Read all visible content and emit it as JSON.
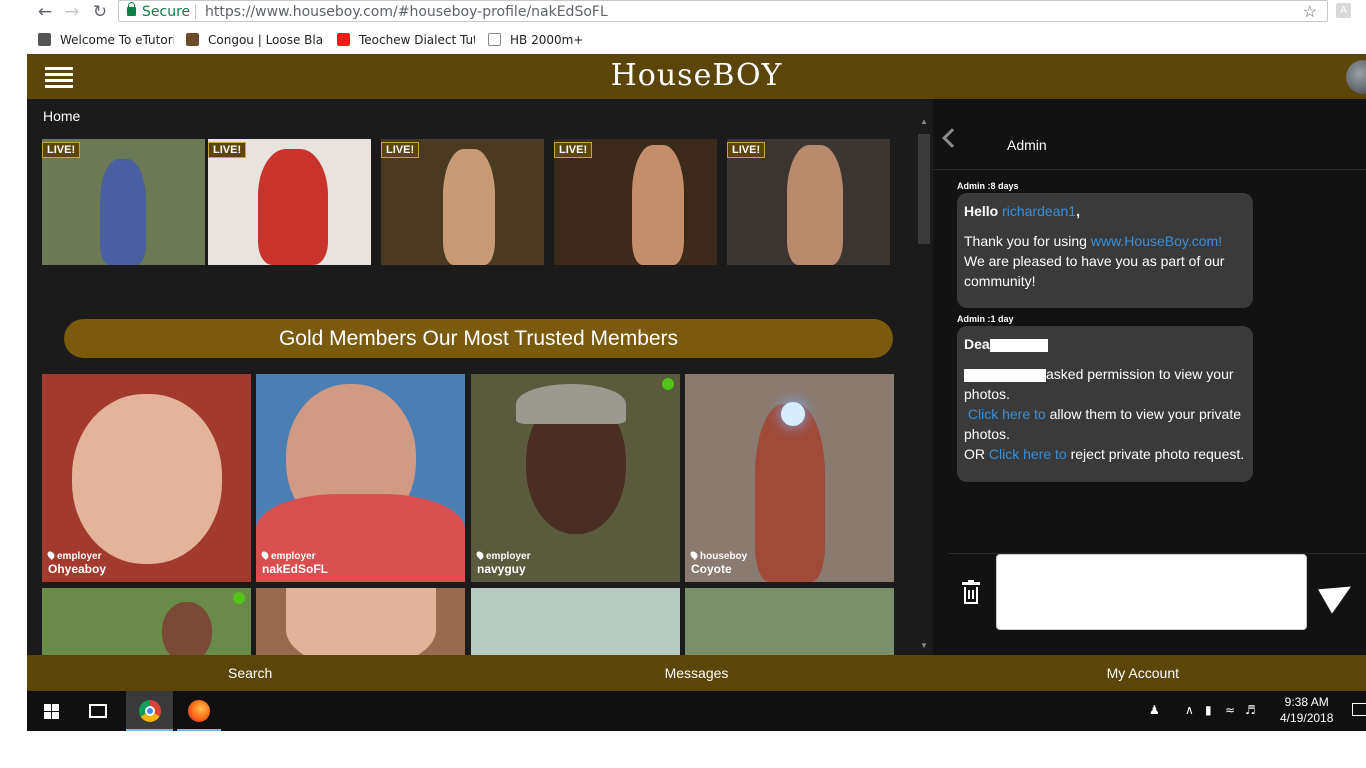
{
  "browser": {
    "back_icon": "back-arrow-icon",
    "forward_icon": "forward-arrow-icon",
    "reload_icon": "reload-icon",
    "secure_label": "Secure",
    "url": "https://www.houseboy.com/#houseboy-profile/nakEdSoFL",
    "extension_label": "A",
    "bookmarks": [
      {
        "label": "Welcome To eTutorin",
        "color": "#555555"
      },
      {
        "label": "Congou | Loose Black",
        "color": "#6b4b2a"
      },
      {
        "label": "Teochew Dialect Tuto",
        "color": "#e62117"
      },
      {
        "label": "HB 2000m+",
        "color": "#ffffff"
      }
    ]
  },
  "app": {
    "brand": "HouseBOY",
    "breadcrumb": "Home",
    "accent": "#5c4509",
    "live_badge": "LIVE!",
    "live_streams": [
      {
        "badge": "LIVE!",
        "bg": "#6b7a55"
      },
      {
        "badge": "LIVE!",
        "bg": "#e8e3de"
      },
      {
        "badge": "LIVE!",
        "bg": "#4a3a22"
      },
      {
        "badge": "LIVE!",
        "bg": "#3b2a1a"
      },
      {
        "badge": "LIVE!",
        "bg": "#3d3530"
      }
    ],
    "gold_banner": "Gold Members Our Most Trusted Members",
    "members": [
      {
        "role": "employer",
        "name": "Ohyeaboy",
        "online": false,
        "bg": "#a33a2e"
      },
      {
        "role": "employer",
        "name": "nakEdSoFL",
        "online": false,
        "bg": "#4b7fb3"
      },
      {
        "role": "employer",
        "name": "navyguy",
        "online": true,
        "bg": "#5a5a3c"
      },
      {
        "role": "houseboy",
        "name": "Coyote",
        "online": false,
        "bg": "#8a7a70"
      }
    ],
    "members_row2": [
      {
        "online": true,
        "bg": "#6a8a4a"
      },
      {
        "online": false,
        "bg": "#9a6a50"
      },
      {
        "online": false,
        "bg": "#b7c9c0"
      },
      {
        "online": false,
        "bg": "#7a8f6a"
      }
    ],
    "bottom_nav": [
      "Search",
      "Messages",
      "My Account"
    ]
  },
  "chat": {
    "title": "Admin",
    "messages": [
      {
        "meta": "Admin :8 days",
        "greeting": "Hello",
        "username": "richardean1",
        "line1_pre": "Thank you for using",
        "line1_link": "www.HouseBoy.com!",
        "line1_post": "We are pleased to have you as part of our community!"
      },
      {
        "meta": "Admin :1 day",
        "greeting": "Dea",
        "asked": "asked permission to view your photos.",
        "link1": "Click here to",
        "allow": "allow them to view your private photos.",
        "or": "OR",
        "link2": "Click here to",
        "reject": "reject private photo request."
      }
    ],
    "input_placeholder": ""
  },
  "taskbar": {
    "time": "9:38 AM",
    "date": "4/19/2018"
  }
}
